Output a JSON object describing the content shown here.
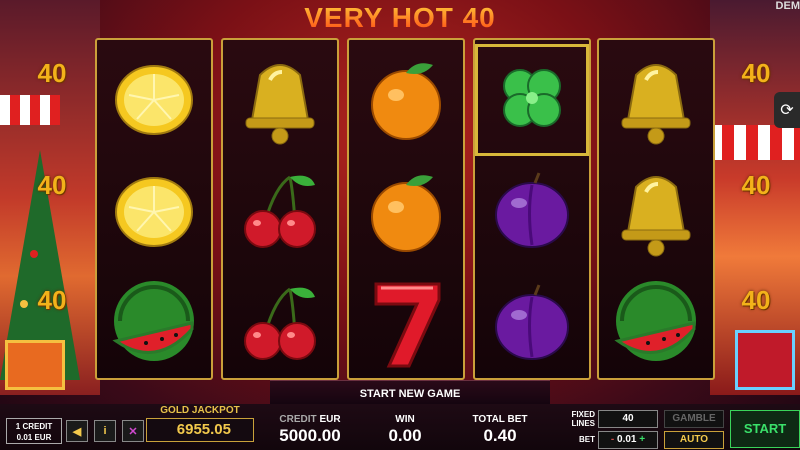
{
  "game": {
    "title": "VERY HOT 40",
    "mode_badge": "DEM"
  },
  "side_lines": {
    "left": [
      "40",
      "40",
      "40"
    ],
    "right": [
      "40",
      "40",
      "40"
    ]
  },
  "reels": [
    [
      "lemon-icon",
      "lemon-icon",
      "watermelon-icon"
    ],
    [
      "bell-icon",
      "cherry-icon",
      "cherry-icon"
    ],
    [
      "orange-icon",
      "orange-icon",
      "seven-icon"
    ],
    [
      "clover-icon",
      "plum-icon",
      "plum-icon"
    ],
    [
      "bell-icon",
      "bell-icon",
      "watermelon-icon"
    ]
  ],
  "status_message": "START NEW GAME",
  "credit_info": {
    "line1": "1 CREDIT",
    "line2": "0.01 EUR"
  },
  "buttons": {
    "sound_glyph": "◀",
    "info_glyph": "i",
    "fullscreen_glyph": "✕",
    "restart_glyph": "⟳"
  },
  "jackpot": {
    "label": "GOLD JACKPOT",
    "value": "6955.05"
  },
  "stats": {
    "credit_label": "CREDIT",
    "credit_currency": "EUR",
    "credit_value": "5000.00",
    "win_label": "WIN",
    "win_value": "0.00",
    "total_bet_label": "TOTAL BET",
    "total_bet_value": "0.40"
  },
  "controls": {
    "fixed_lines_label_1": "FIXED",
    "fixed_lines_label_2": "LINES",
    "fixed_lines_value": "40",
    "bet_label": "BET",
    "bet_minus": "-",
    "bet_value": "0.01",
    "bet_plus": "+",
    "gamble_label": "GAMBLE",
    "auto_label": "AUTO",
    "start_label": "START"
  },
  "colors": {
    "accent_gold": "#f3b21a",
    "start_green": "#3ae06a",
    "reel_border": "#caa03a"
  }
}
